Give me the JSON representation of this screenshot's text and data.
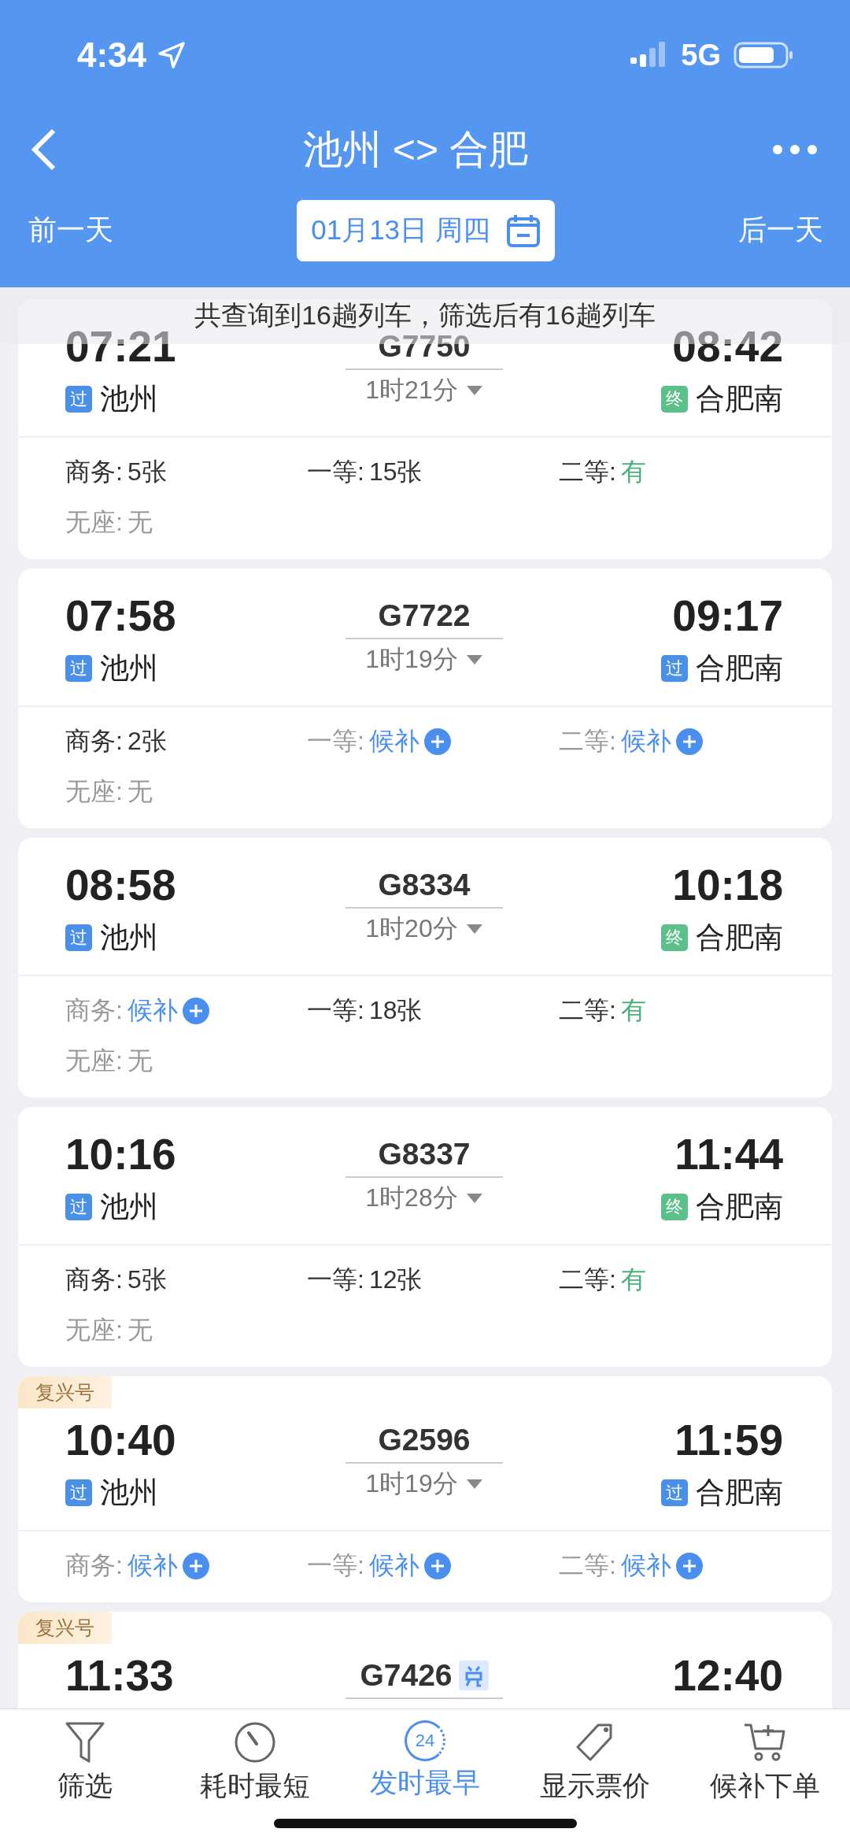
{
  "status_bar": {
    "time": "4:34",
    "network": "5G"
  },
  "header": {
    "title": "池州 <> 合肥",
    "prev_day": "前一天",
    "date": "01月13日 周四",
    "next_day": "后一天"
  },
  "summary": "共查询到16趟列车，筛选后有16趟列车",
  "trains": [
    {
      "depart_time": "07:21",
      "train_no": "G7750",
      "arrive_time": "08:42",
      "from": {
        "badge": "过",
        "kind": "pass",
        "name": "池州"
      },
      "duration": "1时21分",
      "to": {
        "badge": "终",
        "kind": "end",
        "name": "合肥南"
      },
      "seats": [
        {
          "label": "商务:",
          "value": "5张",
          "kind": "count"
        },
        {
          "label": "一等:",
          "value": "15张",
          "kind": "count"
        },
        {
          "label": "二等:",
          "value": "有",
          "kind": "yes"
        },
        {
          "label": "无座:",
          "value": "无",
          "kind": "none"
        }
      ]
    },
    {
      "depart_time": "07:58",
      "train_no": "G7722",
      "arrive_time": "09:17",
      "from": {
        "badge": "过",
        "kind": "pass",
        "name": "池州"
      },
      "duration": "1时19分",
      "to": {
        "badge": "过",
        "kind": "pass",
        "name": "合肥南"
      },
      "seats": [
        {
          "label": "商务:",
          "value": "2张",
          "kind": "count"
        },
        {
          "label": "一等:",
          "value": "候补",
          "kind": "waitlist"
        },
        {
          "label": "二等:",
          "value": "候补",
          "kind": "waitlist"
        },
        {
          "label": "无座:",
          "value": "无",
          "kind": "none"
        }
      ]
    },
    {
      "depart_time": "08:58",
      "train_no": "G8334",
      "arrive_time": "10:18",
      "from": {
        "badge": "过",
        "kind": "pass",
        "name": "池州"
      },
      "duration": "1时20分",
      "to": {
        "badge": "终",
        "kind": "end",
        "name": "合肥南"
      },
      "seats": [
        {
          "label": "商务:",
          "value": "候补",
          "kind": "waitlist"
        },
        {
          "label": "一等:",
          "value": "18张",
          "kind": "count"
        },
        {
          "label": "二等:",
          "value": "有",
          "kind": "yes"
        },
        {
          "label": "无座:",
          "value": "无",
          "kind": "none"
        }
      ]
    },
    {
      "depart_time": "10:16",
      "train_no": "G8337",
      "arrive_time": "11:44",
      "from": {
        "badge": "过",
        "kind": "pass",
        "name": "池州"
      },
      "duration": "1时28分",
      "to": {
        "badge": "终",
        "kind": "end",
        "name": "合肥南"
      },
      "seats": [
        {
          "label": "商务:",
          "value": "5张",
          "kind": "count"
        },
        {
          "label": "一等:",
          "value": "12张",
          "kind": "count"
        },
        {
          "label": "二等:",
          "value": "有",
          "kind": "yes"
        },
        {
          "label": "无座:",
          "value": "无",
          "kind": "none"
        }
      ]
    },
    {
      "tag": "复兴号",
      "depart_time": "10:40",
      "train_no": "G2596",
      "arrive_time": "11:59",
      "from": {
        "badge": "过",
        "kind": "pass",
        "name": "池州"
      },
      "duration": "1时19分",
      "to": {
        "badge": "过",
        "kind": "pass",
        "name": "合肥南"
      },
      "seats": [
        {
          "label": "商务:",
          "value": "候补",
          "kind": "waitlist"
        },
        {
          "label": "一等:",
          "value": "候补",
          "kind": "waitlist"
        },
        {
          "label": "二等:",
          "value": "候补",
          "kind": "waitlist"
        }
      ]
    },
    {
      "tag": "复兴号",
      "depart_time": "11:33",
      "train_no": "G7426",
      "train_badge": true,
      "arrive_time": "12:40"
    }
  ],
  "bottom_tabs": [
    {
      "label": "筛选",
      "kind": "filter",
      "selected": false
    },
    {
      "label": "耗时最短",
      "kind": "stopwatch",
      "selected": false
    },
    {
      "label": "发时最早",
      "kind": "clock",
      "icon_text": "24",
      "selected": true
    },
    {
      "label": "显示票价",
      "kind": "tag",
      "selected": false
    },
    {
      "label": "候补下单",
      "kind": "cart",
      "selected": false
    }
  ]
}
